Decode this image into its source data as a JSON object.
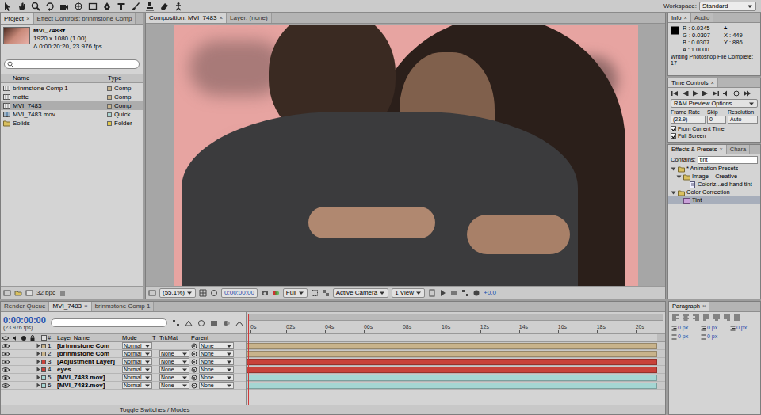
{
  "toolbar": {
    "workspace_label": "Workspace:",
    "workspace": "Standard"
  },
  "project": {
    "tabs": [
      {
        "label": "Project",
        "close": "×",
        "selected": true
      },
      {
        "label": "Effect Controls: brinmstone Comp",
        "selected": false
      }
    ],
    "footage": {
      "name": "MVI_7483▾",
      "size": "1920 x 1080 (1.00)",
      "duration": "Δ 0:00:20:20, 23.976 fps"
    },
    "columns": [
      "Name",
      "Type"
    ],
    "items": [
      {
        "name": "brinmstone Comp 1",
        "type": "Comp",
        "kind": "comp",
        "color": "#c8b48c",
        "selected": false
      },
      {
        "name": "matte",
        "type": "Comp",
        "kind": "comp",
        "color": "#c8b48c",
        "selected": false
      },
      {
        "name": "MVI_7483",
        "type": "Comp",
        "kind": "comp",
        "color": "#c8b48c",
        "selected": true
      },
      {
        "name": "MVI_7483.mov",
        "type": "Quick",
        "kind": "footage",
        "color": "#a8d4d2",
        "selected": false
      },
      {
        "name": "Solids",
        "type": "Folder",
        "kind": "folder",
        "color": "#e0c84a",
        "selected": false
      }
    ],
    "bpc": "32 bpc"
  },
  "composition": {
    "tabs": [
      {
        "label": "Composition: MVI_7483",
        "close": "×",
        "selected": true
      },
      {
        "label": "Layer: (none)",
        "selected": false
      }
    ],
    "footer": {
      "zoom": "(55.1%)",
      "time": "0:00:00:00",
      "resolution": "Full",
      "camera": "Active Camera",
      "views": "1 View",
      "exposure": "+0.0"
    }
  },
  "info": {
    "tabs": [
      {
        "label": "Info",
        "close": "×",
        "selected": true
      },
      {
        "label": "Audio",
        "selected": false
      }
    ],
    "channels": [
      {
        "label": "R :",
        "value": "0.0345"
      },
      {
        "label": "G :",
        "value": "0.0307"
      },
      {
        "label": "B :",
        "value": "0.0307"
      },
      {
        "label": "A :",
        "value": "1.0000"
      }
    ],
    "cursor": "+",
    "coords": [
      {
        "label": "X :",
        "value": "449"
      },
      {
        "label": "Y :",
        "value": "886"
      }
    ],
    "message": "Writing Photoshop File Complete: 17"
  },
  "time_controls": {
    "tabs": [
      {
        "label": "Time Controls",
        "close": "×",
        "selected": true
      }
    ],
    "preset": "RAM Preview Options",
    "fields": [
      {
        "label": "Frame Rate",
        "value": "(23.9)"
      },
      {
        "label": "Skip",
        "value": "0"
      },
      {
        "label": "Resolution",
        "value": "Auto"
      }
    ],
    "options": [
      {
        "label": "From Current Time",
        "checked": true
      },
      {
        "label": "Full Screen",
        "checked": true
      }
    ]
  },
  "effects": {
    "tabs": [
      {
        "label": "Effects & Presets",
        "close": "×",
        "selected": true
      },
      {
        "label": "Chara",
        "selected": false
      }
    ],
    "search_label": "Contains:",
    "search": "tint",
    "tree": [
      {
        "label": "* Animation Presets",
        "kind": "folder",
        "depth": 0,
        "expanded": true,
        "selected": false
      },
      {
        "label": "Image – Creative",
        "kind": "folder",
        "depth": 1,
        "expanded": true,
        "selected": false
      },
      {
        "label": "Coloriz...ed hand tint",
        "kind": "preset",
        "depth": 2,
        "selected": false
      },
      {
        "label": "Color Correction",
        "kind": "folder",
        "depth": 0,
        "expanded": true,
        "selected": false
      },
      {
        "label": "Tint",
        "kind": "effect",
        "depth": 1,
        "selected": true
      }
    ]
  },
  "timeline": {
    "tabs": [
      {
        "label": "Render Queue",
        "selected": false
      },
      {
        "label": "MVI_7483",
        "close": "×",
        "selected": true
      },
      {
        "label": "brinmstone Comp 1",
        "selected": false
      }
    ],
    "time": "0:00:00:00",
    "fps": "(23.976 fps)",
    "ruler": [
      "0s",
      "02s",
      "04s",
      "06s",
      "08s",
      "10s",
      "12s",
      "14s",
      "16s",
      "18s",
      "20s"
    ],
    "columns": {
      "index": "#",
      "name": "Layer Name",
      "mode": "Mode",
      "t": "T",
      "trkmat": "TrkMat",
      "parent": "Parent"
    },
    "layers": [
      {
        "index": "1",
        "name": "[brinmstone Com",
        "mode": "Normal",
        "parent": "None",
        "color": "#c8b38b",
        "visible": true
      },
      {
        "index": "2",
        "name": "[brinmstone Com",
        "mode": "Normal",
        "trkmat": "None",
        "parent": "None",
        "color": "#c8b38b",
        "visible": true
      },
      {
        "index": "3",
        "name": "[Adjustment Layer]",
        "mode": "Normal",
        "trkmat": "None",
        "parent": "None",
        "color": "#c8423a",
        "visible": true
      },
      {
        "index": "4",
        "name": "eyes",
        "mode": "Normal",
        "trkmat": "None",
        "parent": "None",
        "color": "#c8423a",
        "visible": true
      },
      {
        "index": "5",
        "name": "[MVI_7483.mov]",
        "mode": "Normal",
        "trkmat": "None",
        "parent": "None",
        "color": "#a5d6d3",
        "visible": true
      },
      {
        "index": "6",
        "name": "[MVI_7483.mov]",
        "mode": "Normal",
        "trkmat": "None",
        "parent": "None",
        "color": "#a5d6d3",
        "visible": true
      }
    ],
    "footer": "Toggle Switches / Modes"
  },
  "paragraph": {
    "tabs": [
      {
        "label": "Paragraph",
        "close": "×",
        "selected": true
      }
    ],
    "fields": [
      "0 px",
      "0 px",
      "0 px",
      "0 px",
      "0 px"
    ]
  }
}
